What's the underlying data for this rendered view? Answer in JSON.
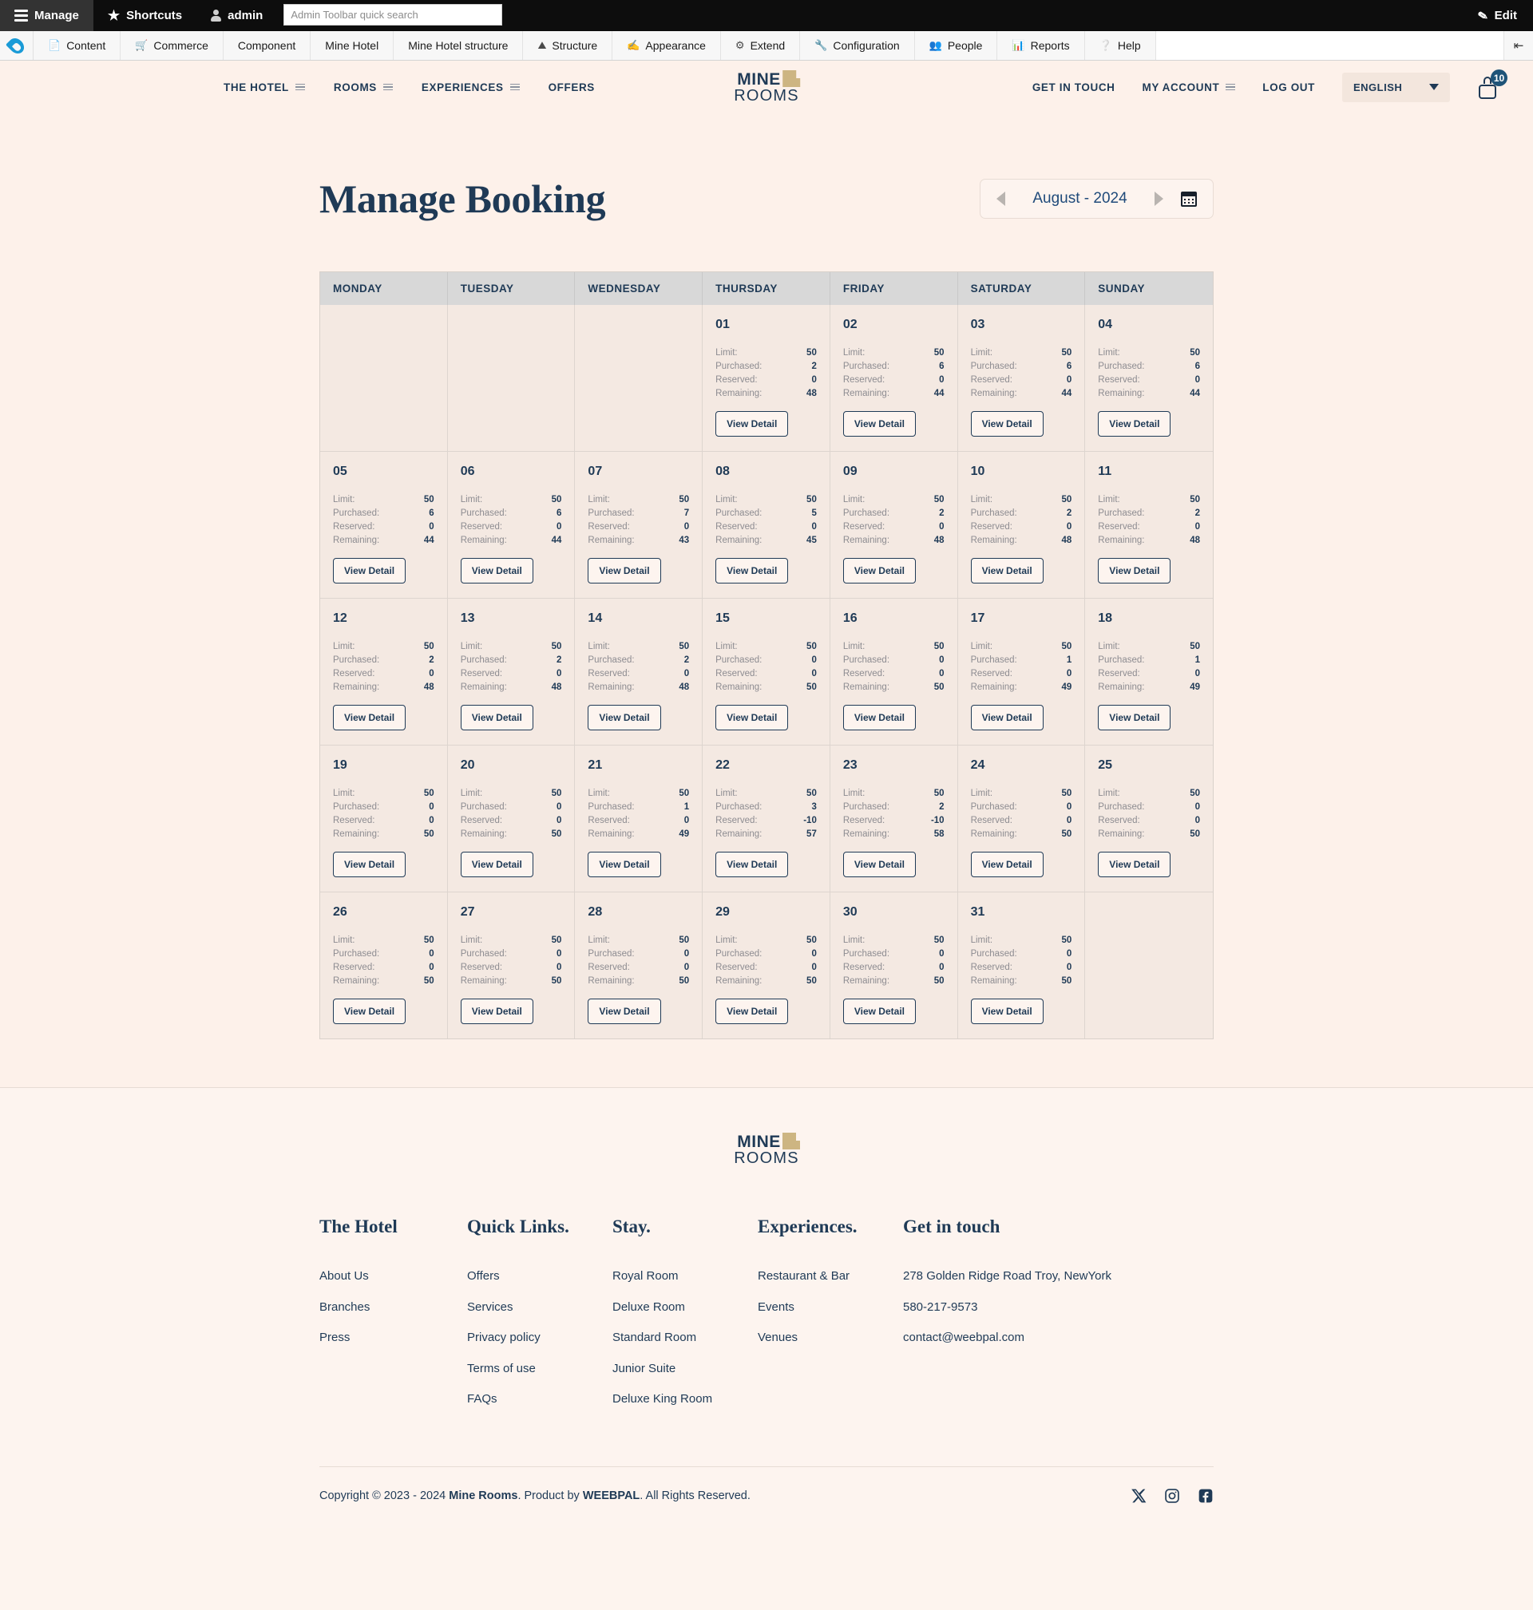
{
  "admin_toolbar": {
    "tabs": [
      {
        "label": "Manage",
        "icon": "hamburger-icon",
        "active": true
      },
      {
        "label": "Shortcuts",
        "icon": "star-icon",
        "active": false
      },
      {
        "label": "admin",
        "icon": "user-icon",
        "active": false
      }
    ],
    "search_placeholder": "Admin Toolbar quick search",
    "search_value": "",
    "edit_label": "Edit",
    "edit_icon": "pencil-icon",
    "menu": [
      {
        "label": "Content",
        "icon": "file-icon"
      },
      {
        "label": "Commerce",
        "icon": "cart-icon"
      },
      {
        "label": "Component",
        "icon": ""
      },
      {
        "label": "Mine Hotel",
        "icon": ""
      },
      {
        "label": "Mine Hotel structure",
        "icon": ""
      },
      {
        "label": "Structure",
        "icon": "structure-icon"
      },
      {
        "label": "Appearance",
        "icon": "paintbrush-icon"
      },
      {
        "label": "Extend",
        "icon": "puzzle-icon"
      },
      {
        "label": "Configuration",
        "icon": "wrench-icon"
      },
      {
        "label": "People",
        "icon": "people-icon"
      },
      {
        "label": "Reports",
        "icon": "bars-icon"
      },
      {
        "label": "Help",
        "icon": "question-icon"
      }
    ],
    "collapse_icon": "collapse-sidebar-icon"
  },
  "site_header": {
    "nav": [
      {
        "label": "THE HOTEL",
        "has_menu": true
      },
      {
        "label": "ROOMS",
        "has_menu": true
      },
      {
        "label": "EXPERIENCES",
        "has_menu": true
      },
      {
        "label": "OFFERS",
        "has_menu": false
      }
    ],
    "logo": {
      "line1": "MINE",
      "line2": "ROOMS",
      "icon": "building-icon"
    },
    "right_nav": [
      {
        "label": "GET IN TOUCH",
        "has_menu": false
      },
      {
        "label": "MY ACCOUNT",
        "has_menu": true
      },
      {
        "label": "LOG OUT",
        "has_menu": false
      }
    ],
    "language": {
      "value": "ENGLISH",
      "icon": "chevron-down-icon"
    },
    "cart": {
      "icon": "cart-icon",
      "badge": "10"
    }
  },
  "page": {
    "title": "Manage Booking",
    "month_nav": {
      "prev_icon": "arrow-left-icon",
      "next_icon": "arrow-right-icon",
      "label": "August - 2024",
      "calendar_icon": "calendar-icon"
    }
  },
  "calendar": {
    "weekdays": [
      "MONDAY",
      "TUESDAY",
      "WEDNESDAY",
      "THURSDAY",
      "FRIDAY",
      "SATURDAY",
      "SUNDAY"
    ],
    "stat_labels": {
      "limit": "Limit:",
      "purchased": "Purchased:",
      "reserved": "Reserved:",
      "remaining": "Remaining:"
    },
    "view_detail_label": "View Detail",
    "weeks": [
      [
        null,
        null,
        null,
        {
          "day": "01",
          "limit": "50",
          "purchased": "2",
          "reserved": "0",
          "remaining": "48"
        },
        {
          "day": "02",
          "limit": "50",
          "purchased": "6",
          "reserved": "0",
          "remaining": "44"
        },
        {
          "day": "03",
          "limit": "50",
          "purchased": "6",
          "reserved": "0",
          "remaining": "44"
        },
        {
          "day": "04",
          "limit": "50",
          "purchased": "6",
          "reserved": "0",
          "remaining": "44"
        }
      ],
      [
        {
          "day": "05",
          "limit": "50",
          "purchased": "6",
          "reserved": "0",
          "remaining": "44"
        },
        {
          "day": "06",
          "limit": "50",
          "purchased": "6",
          "reserved": "0",
          "remaining": "44"
        },
        {
          "day": "07",
          "limit": "50",
          "purchased": "7",
          "reserved": "0",
          "remaining": "43"
        },
        {
          "day": "08",
          "limit": "50",
          "purchased": "5",
          "reserved": "0",
          "remaining": "45"
        },
        {
          "day": "09",
          "limit": "50",
          "purchased": "2",
          "reserved": "0",
          "remaining": "48"
        },
        {
          "day": "10",
          "limit": "50",
          "purchased": "2",
          "reserved": "0",
          "remaining": "48"
        },
        {
          "day": "11",
          "limit": "50",
          "purchased": "2",
          "reserved": "0",
          "remaining": "48"
        }
      ],
      [
        {
          "day": "12",
          "limit": "50",
          "purchased": "2",
          "reserved": "0",
          "remaining": "48"
        },
        {
          "day": "13",
          "limit": "50",
          "purchased": "2",
          "reserved": "0",
          "remaining": "48"
        },
        {
          "day": "14",
          "limit": "50",
          "purchased": "2",
          "reserved": "0",
          "remaining": "48"
        },
        {
          "day": "15",
          "limit": "50",
          "purchased": "0",
          "reserved": "0",
          "remaining": "50"
        },
        {
          "day": "16",
          "limit": "50",
          "purchased": "0",
          "reserved": "0",
          "remaining": "50"
        },
        {
          "day": "17",
          "limit": "50",
          "purchased": "1",
          "reserved": "0",
          "remaining": "49"
        },
        {
          "day": "18",
          "limit": "50",
          "purchased": "1",
          "reserved": "0",
          "remaining": "49"
        }
      ],
      [
        {
          "day": "19",
          "limit": "50",
          "purchased": "0",
          "reserved": "0",
          "remaining": "50"
        },
        {
          "day": "20",
          "limit": "50",
          "purchased": "0",
          "reserved": "0",
          "remaining": "50"
        },
        {
          "day": "21",
          "limit": "50",
          "purchased": "1",
          "reserved": "0",
          "remaining": "49"
        },
        {
          "day": "22",
          "limit": "50",
          "purchased": "3",
          "reserved": "-10",
          "remaining": "57"
        },
        {
          "day": "23",
          "limit": "50",
          "purchased": "2",
          "reserved": "-10",
          "remaining": "58"
        },
        {
          "day": "24",
          "limit": "50",
          "purchased": "0",
          "reserved": "0",
          "remaining": "50"
        },
        {
          "day": "25",
          "limit": "50",
          "purchased": "0",
          "reserved": "0",
          "remaining": "50"
        }
      ],
      [
        {
          "day": "26",
          "limit": "50",
          "purchased": "0",
          "reserved": "0",
          "remaining": "50"
        },
        {
          "day": "27",
          "limit": "50",
          "purchased": "0",
          "reserved": "0",
          "remaining": "50"
        },
        {
          "day": "28",
          "limit": "50",
          "purchased": "0",
          "reserved": "0",
          "remaining": "50"
        },
        {
          "day": "29",
          "limit": "50",
          "purchased": "0",
          "reserved": "0",
          "remaining": "50"
        },
        {
          "day": "30",
          "limit": "50",
          "purchased": "0",
          "reserved": "0",
          "remaining": "50"
        },
        {
          "day": "31",
          "limit": "50",
          "purchased": "0",
          "reserved": "0",
          "remaining": "50"
        },
        null
      ]
    ]
  },
  "footer": {
    "logo": {
      "line1": "MINE",
      "line2": "ROOMS",
      "icon": "building-icon"
    },
    "columns": [
      {
        "title": "The Hotel",
        "links": [
          "About Us",
          "Branches",
          "Press"
        ]
      },
      {
        "title": "Quick Links.",
        "links": [
          "Offers",
          "Services",
          "Privacy policy",
          "Terms of use",
          "FAQs"
        ]
      },
      {
        "title": "Stay.",
        "links": [
          "Royal Room",
          "Deluxe Room",
          "Standard Room",
          "Junior Suite",
          "Deluxe King Room"
        ]
      },
      {
        "title": "Experiences.",
        "links": [
          "Restaurant & Bar",
          "Events",
          "Venues"
        ]
      },
      {
        "title": "Get in touch",
        "links": [
          "278 Golden Ridge Road Troy, NewYork",
          "580-217-9573",
          "contact@weebpal.com"
        ]
      }
    ],
    "copyright": {
      "prefix": "Copyright © 2023 - 2024 ",
      "brand": "Mine Rooms",
      "middle": ". Product by ",
      "partner": "WEEBPAL",
      "suffix": ". All Rights Reserved."
    },
    "socials": [
      {
        "name": "x-twitter-icon"
      },
      {
        "name": "instagram-icon"
      },
      {
        "name": "facebook-icon"
      }
    ]
  },
  "colors": {
    "page_bg": "#fdf1ea",
    "accent_navy": "#1f3a56",
    "calendar_header": "#d8d8d8",
    "cell_bg": "#f4e9e2",
    "gold": "#cdb582"
  }
}
